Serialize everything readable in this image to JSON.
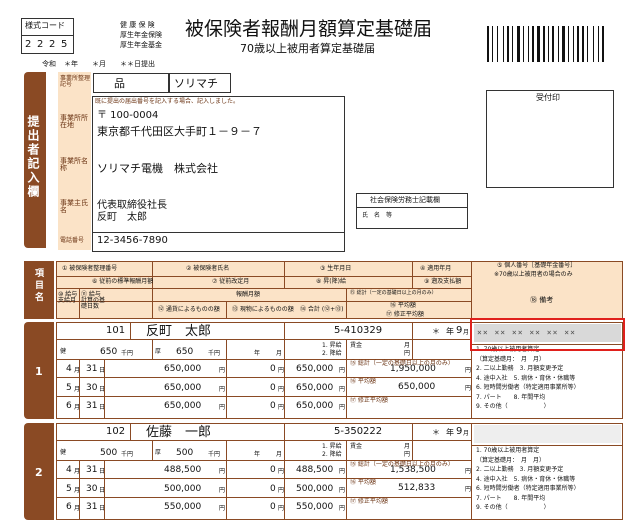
{
  "header": {
    "form_code_label": "様式コード",
    "form_code_digits": [
      "2",
      "2",
      "2",
      "5"
    ],
    "insurance_types": [
      "健 康 保 険",
      "厚生年金保険",
      "厚生年金基金"
    ],
    "title": "被保険者報酬月額算定基礎届",
    "subtitle": "70歳以上被用者算定基礎届",
    "date_era": "令和",
    "date_text": "＊年　　＊月　　＊＊日提出"
  },
  "submitter": {
    "side_label": "提出者記入欄",
    "office_code_label": "事業所整理記号",
    "office_code_1": "品",
    "office_code_2": "ソリマチ",
    "address_note": "既に提出の届出番号を記入する場合、記入しました。",
    "address_label": "事業所所在地",
    "postal": "〒 100-0004",
    "address": "東京都千代田区大手町１－９－７",
    "name_label": "事業所名称",
    "name": "ソリマチ電機　株式会社",
    "owner_label": "事業主氏名",
    "owner_title": "代表取締役社長",
    "owner_name": "反町　太郎",
    "phone_label": "電話番号",
    "phone": "12-3456-7890",
    "receipt_label": "受付印",
    "sharoushi_label": "社会保険労務士記載欄",
    "sharoushi_name_label": "氏　名　等"
  },
  "columns": {
    "side_label": "項目名",
    "c1": "① 被保険者整理番号",
    "c2": "② 被保険者氏名",
    "c3": "③ 生年月日",
    "c4": "④ 適用年月",
    "c5": "⑤ 個人番号［基礎年金番号］",
    "c5_note": "※70歳以上被用者の場合のみ",
    "c6": "⑥ 従前の標準報酬月額",
    "c7": "⑦ 従前改定月",
    "c8": "⑧ 昇(降)給",
    "c9": "⑨ 遡及支払額",
    "c10": "⑩ 給与支給月",
    "c11": "⑪ 給与計算の基礎日数",
    "c12": "報酬月額",
    "c12a": "⑫ 通貨によるものの額",
    "c12b": "⑬ 現物によるものの額",
    "c14": "⑭ 合計 (⑫+⑬)",
    "c15": "⑮ 総計（一定の基礎日以上の月のみ）",
    "c16": "⑯ 平均額",
    "c17": "⑰ 修正平均額",
    "c18": "⑱ 備考",
    "row_num_prefix": "⑩",
    "health": "健",
    "pension": "厚",
    "unit_thousand": "千円",
    "unit_yen": "円",
    "unit_day": "日",
    "unit_month": "月",
    "unit_year": "年",
    "raise": "1. 昇給",
    "lower": "2. 降給",
    "wage": "賃金",
    "month_label": "月"
  },
  "employees": [
    {
      "index": "1",
      "number": "101",
      "name": "反町　太郎",
      "birth": "5-410329",
      "apply_year": "＊",
      "apply_month": "9",
      "health_prev": "650",
      "pension_prev": "650",
      "months": [
        {
          "month": "4",
          "days": "31",
          "cash": "650,000",
          "kind": "0",
          "total": "650,000"
        },
        {
          "month": "5",
          "days": "30",
          "cash": "650,000",
          "kind": "0",
          "total": "650,000"
        },
        {
          "month": "6",
          "days": "31",
          "cash": "650,000",
          "kind": "0",
          "total": "650,000"
        }
      ],
      "sum": "1,950,000",
      "avg": "650,000",
      "mynumber_mask": "×× ×× ×× ×× ×× ××",
      "remarks": [
        "1. 70歳以上被用者算定",
        "（算定基礎月：　月　月）",
        "2. 二以上勤務　3. 月額変更予定",
        "4. 途中入社　5. 病休・育休・休職等",
        "6. 短時間労働者（特定適用事業所等）",
        "7. パート　　8. 年間平均",
        "9. その他（　　　　　　）"
      ]
    },
    {
      "index": "2",
      "number": "102",
      "name": "佐藤　一郎",
      "birth": "5-350222",
      "apply_year": "＊",
      "apply_month": "9",
      "health_prev": "500",
      "pension_prev": "500",
      "months": [
        {
          "month": "4",
          "days": "31",
          "cash": "488,500",
          "kind": "0",
          "total": "488,500"
        },
        {
          "month": "5",
          "days": "30",
          "cash": "500,000",
          "kind": "0",
          "total": "500,000"
        },
        {
          "month": "6",
          "days": "31",
          "cash": "550,000",
          "kind": "0",
          "total": "550,000"
        }
      ],
      "sum": "1,538,500",
      "avg": "512,833",
      "mynumber_mask": "",
      "remarks": [
        "1. 70歳以上被用者算定",
        "（算定基礎月：　月　月）",
        "2. 二以上勤務　3. 月額変更予定",
        "4. 途中入社　5. 病休・育休・休職等",
        "6. 短時間労働者（特定適用事業所等）",
        "7. パート　　8. 年間平均",
        "9. その他（　　　　　　）"
      ]
    }
  ],
  "colors": {
    "brown": "#8a4a24",
    "peach": "#fbe3c7",
    "highlight": "#e0201c"
  }
}
